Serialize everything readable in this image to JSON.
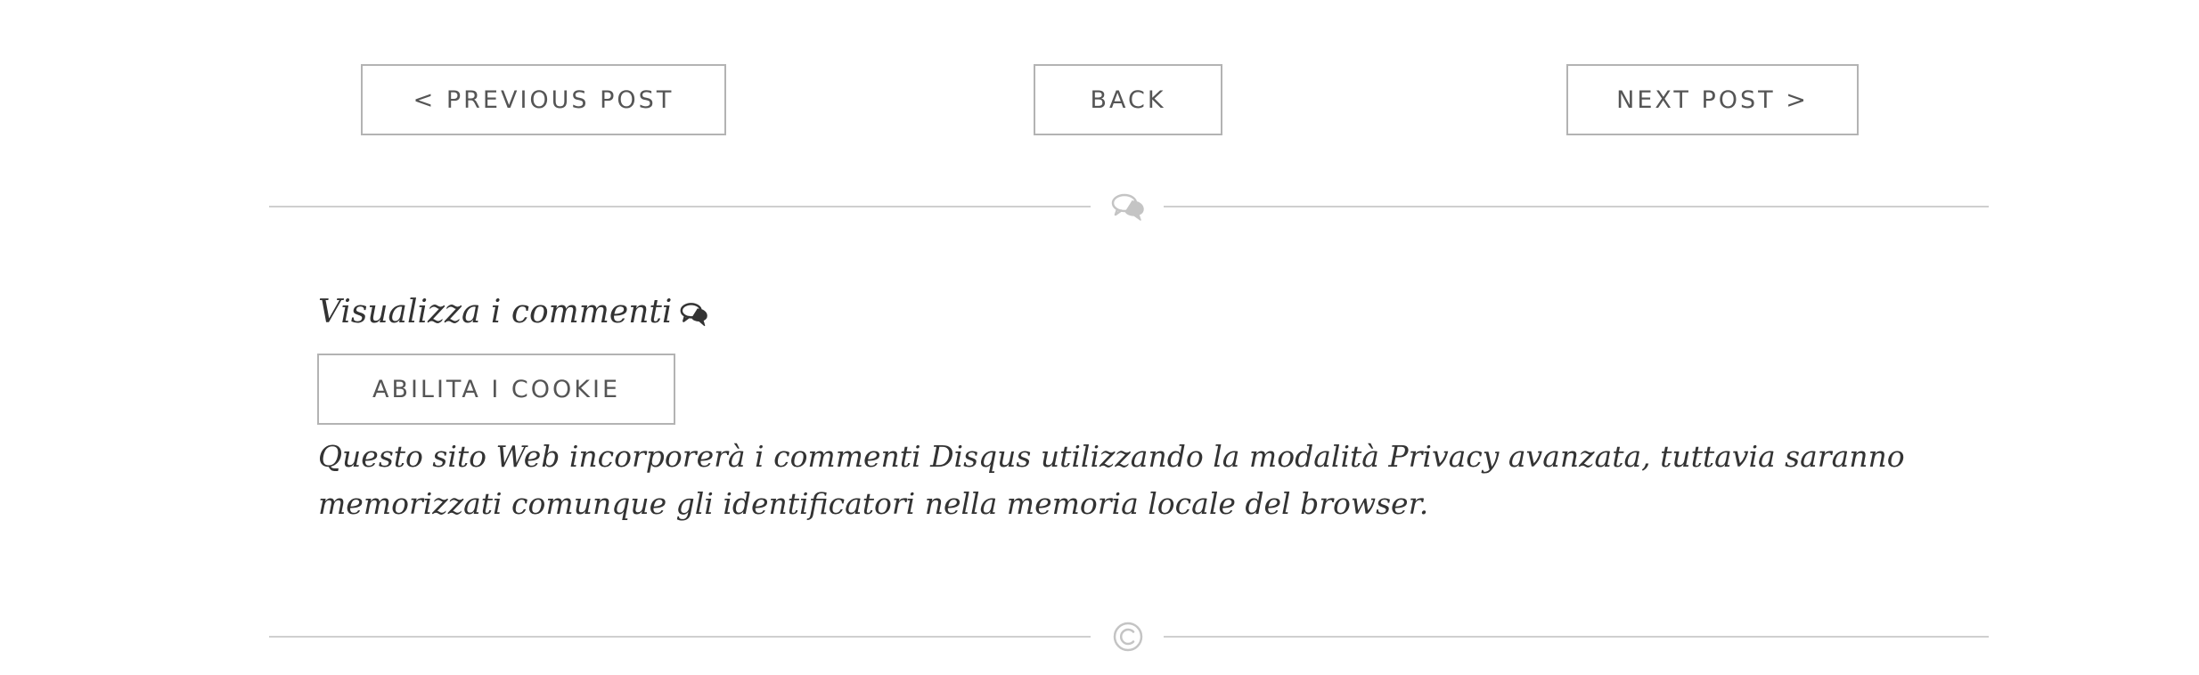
{
  "post_nav": {
    "previous_label": "< PREVIOUS POST",
    "back_label": "BACK",
    "next_label": "NEXT POST >"
  },
  "dividers": [
    {
      "icon": "comments-icon"
    },
    {
      "icon": "copyright-icon"
    }
  ],
  "comments": {
    "title": "Visualizza i commenti",
    "title_icon": "comments-icon",
    "enable_cookies_label": "ABILITA I COOKIE",
    "privacy_note": "Questo sito Web incorporerà i commenti Disqus utilizzando la modalità Privacy avanzata, tuttavia saranno memorizzati comunque gli identificatori nella memoria locale del browser."
  },
  "colors": {
    "border": "#b3b3b3",
    "divider": "#cfcfcf",
    "text": "#333333",
    "button_text": "#555555"
  }
}
